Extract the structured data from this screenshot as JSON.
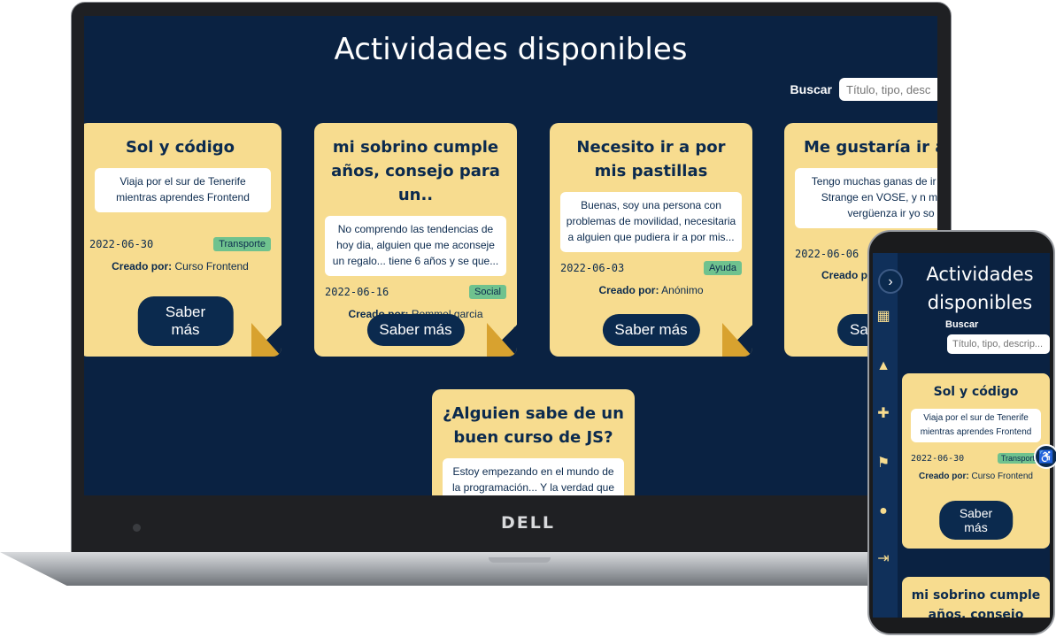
{
  "app": {
    "title": "Actividades disponibles",
    "search_label": "Buscar",
    "search_placeholder": "Título, tipo, descripción",
    "more_button": "Saber más",
    "created_by_label": "Creado por:",
    "laptop_brand": "DELL"
  },
  "cards": [
    {
      "title": "Sol y código",
      "description": "Viaja por el sur de Tenerife mientras aprendes Frontend",
      "date": "2022-06-30",
      "tag": "Transporte",
      "creator": "Curso Frontend"
    },
    {
      "title": "mi sobrino cumple años, consejo para un..",
      "description": "No comprendo las tendencias de hoy dia, alguien que me aconseje un regalo... tiene 6 años y se que...",
      "date": "2022-06-16",
      "tag": "Social",
      "creator": "Rommel garcia coronado"
    },
    {
      "title": "Necesito ir a por mis pastillas",
      "description": "Buenas, soy una persona con problemas de movilidad, necesitaria a alguien que pudiera ir a por mis...",
      "date": "2022-06-03",
      "tag": "Ayuda",
      "creator": "Anónimo"
    },
    {
      "title": "Me gustaría ir al c",
      "description": "Tengo muchas ganas de ir Doctor Strange en VOSE, y n mucha vergüenza ir yo so",
      "date": "2022-06-06",
      "tag": "",
      "creator": ""
    },
    {
      "title": "¿Alguien sabe de un buen curso de JS?",
      "description": "Estoy empezando en el mundo de la programación... Y la verdad que",
      "date": "",
      "tag": "",
      "creator": ""
    }
  ],
  "mobile": {
    "title": "Actividades disponibles",
    "search_label": "Buscar",
    "search_placeholder": "Título, tipo, descrip...",
    "cards": [
      {
        "title": "Sol y código",
        "description": "Viaja por el sur de Tenerife mientras aprendes Frontend",
        "date": "2022-06-30",
        "tag": "Transporte",
        "creator": "Curso Frontend"
      },
      {
        "title": "mi sobrino cumple años, consejo para..."
      }
    ],
    "sidebar_icons": [
      "chevron-right-icon",
      "activities-icon",
      "profile-icon",
      "add-icon",
      "transport-icon",
      "avatar-icon",
      "logout-icon"
    ]
  },
  "colors": {
    "background": "#0a2242",
    "card": "#f7dc8f",
    "accent": "#0b2a4e",
    "tag": "#6fc28e",
    "fold": "#d8a22f"
  }
}
